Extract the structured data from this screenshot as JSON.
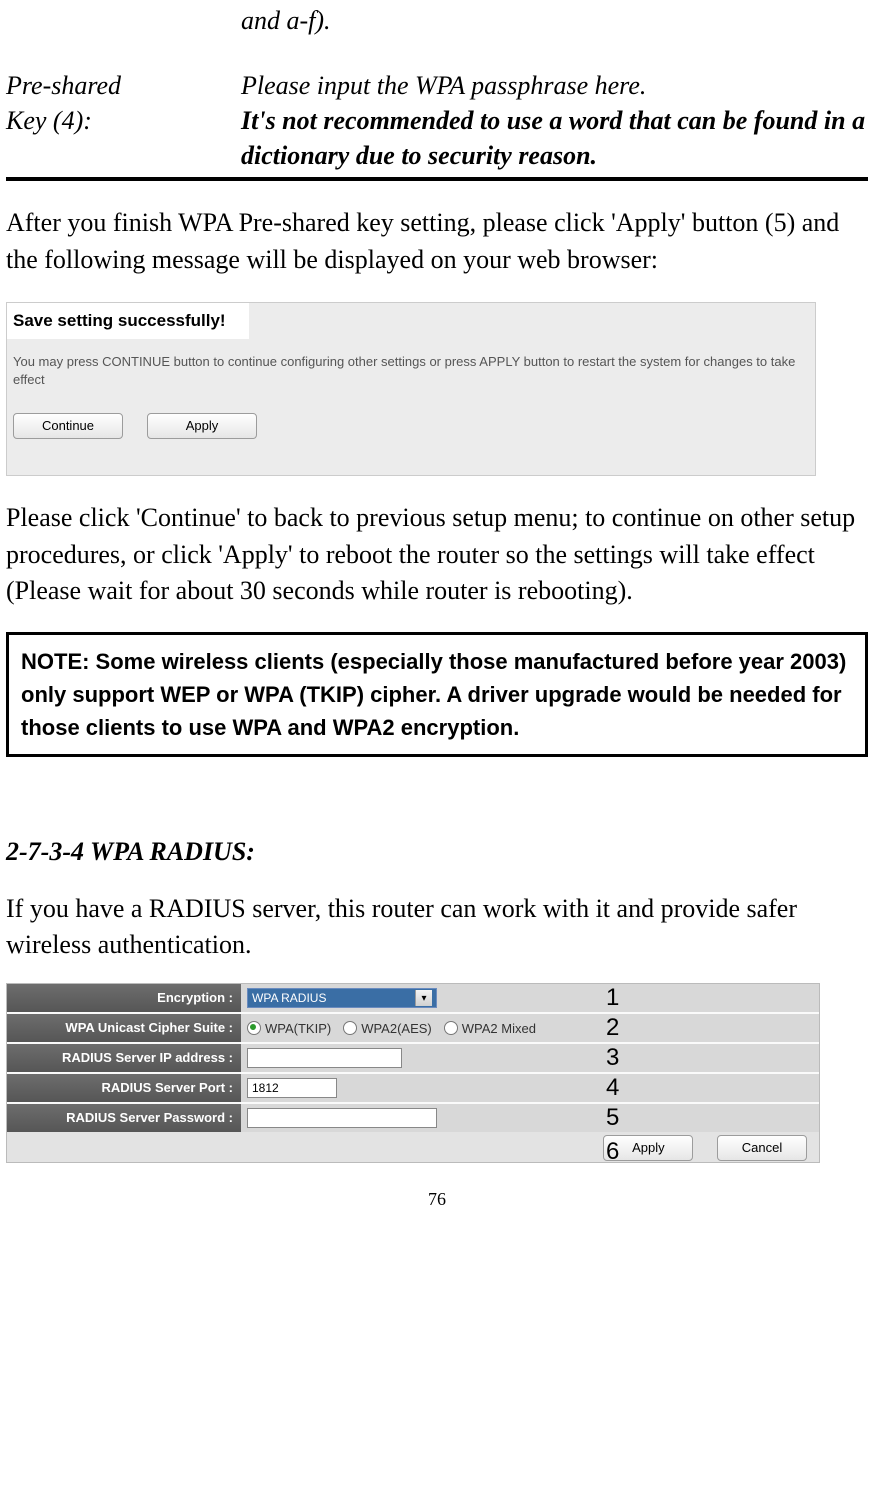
{
  "frag_top": "and a-f).",
  "def": {
    "term_line1": "Pre-shared",
    "term_line2": "Key (4):",
    "body_line1": "Please input the WPA passphrase here.",
    "body_bold": "It's not recommended to use a word that can be found in a dictionary due to security reason."
  },
  "para_after": "After you finish WPA Pre-shared key setting, please click 'Apply' button (5) and the following message will be displayed on your web browser:",
  "savebox": {
    "title": "Save setting successfully!",
    "msg": "You may press CONTINUE button to continue configuring other settings or press APPLY button to restart the system for changes to take effect",
    "continue": "Continue",
    "apply": "Apply"
  },
  "para_continue": "Please click 'Continue' to back to previous setup menu; to continue on other setup procedures, or click 'Apply' to reboot the router so the settings will take effect (Please wait for about 30 seconds while router is rebooting).",
  "note": "NOTE: Some wireless clients (especially those manufactured before year 2003) only support WEP or WPA (TKIP) cipher. A driver upgrade would be needed for those clients to use WPA and WPA2 encryption.",
  "section_heading": "2-7-3-4 WPA RADIUS:",
  "para_radius": "If you have a RADIUS server, this router can work with it and provide safer wireless authentication.",
  "radius": {
    "labels": {
      "encryption": "Encryption :",
      "cipher": "WPA Unicast Cipher Suite :",
      "ip": "RADIUS Server IP address :",
      "port": "RADIUS Server Port :",
      "password": "RADIUS Server Password :"
    },
    "encryption_value": "WPA RADIUS",
    "cipher_options": {
      "tkip": "WPA(TKIP)",
      "aes": "WPA2(AES)",
      "mixed": "WPA2 Mixed",
      "selected": "tkip"
    },
    "ip_value": "",
    "port_value": "1812",
    "password_value": "",
    "apply": "Apply",
    "cancel": "Cancel"
  },
  "annotations": {
    "a1": "1",
    "a2": "2",
    "a3": "3",
    "a4": "4",
    "a5": "5",
    "a6": "6"
  },
  "page_number": "76"
}
